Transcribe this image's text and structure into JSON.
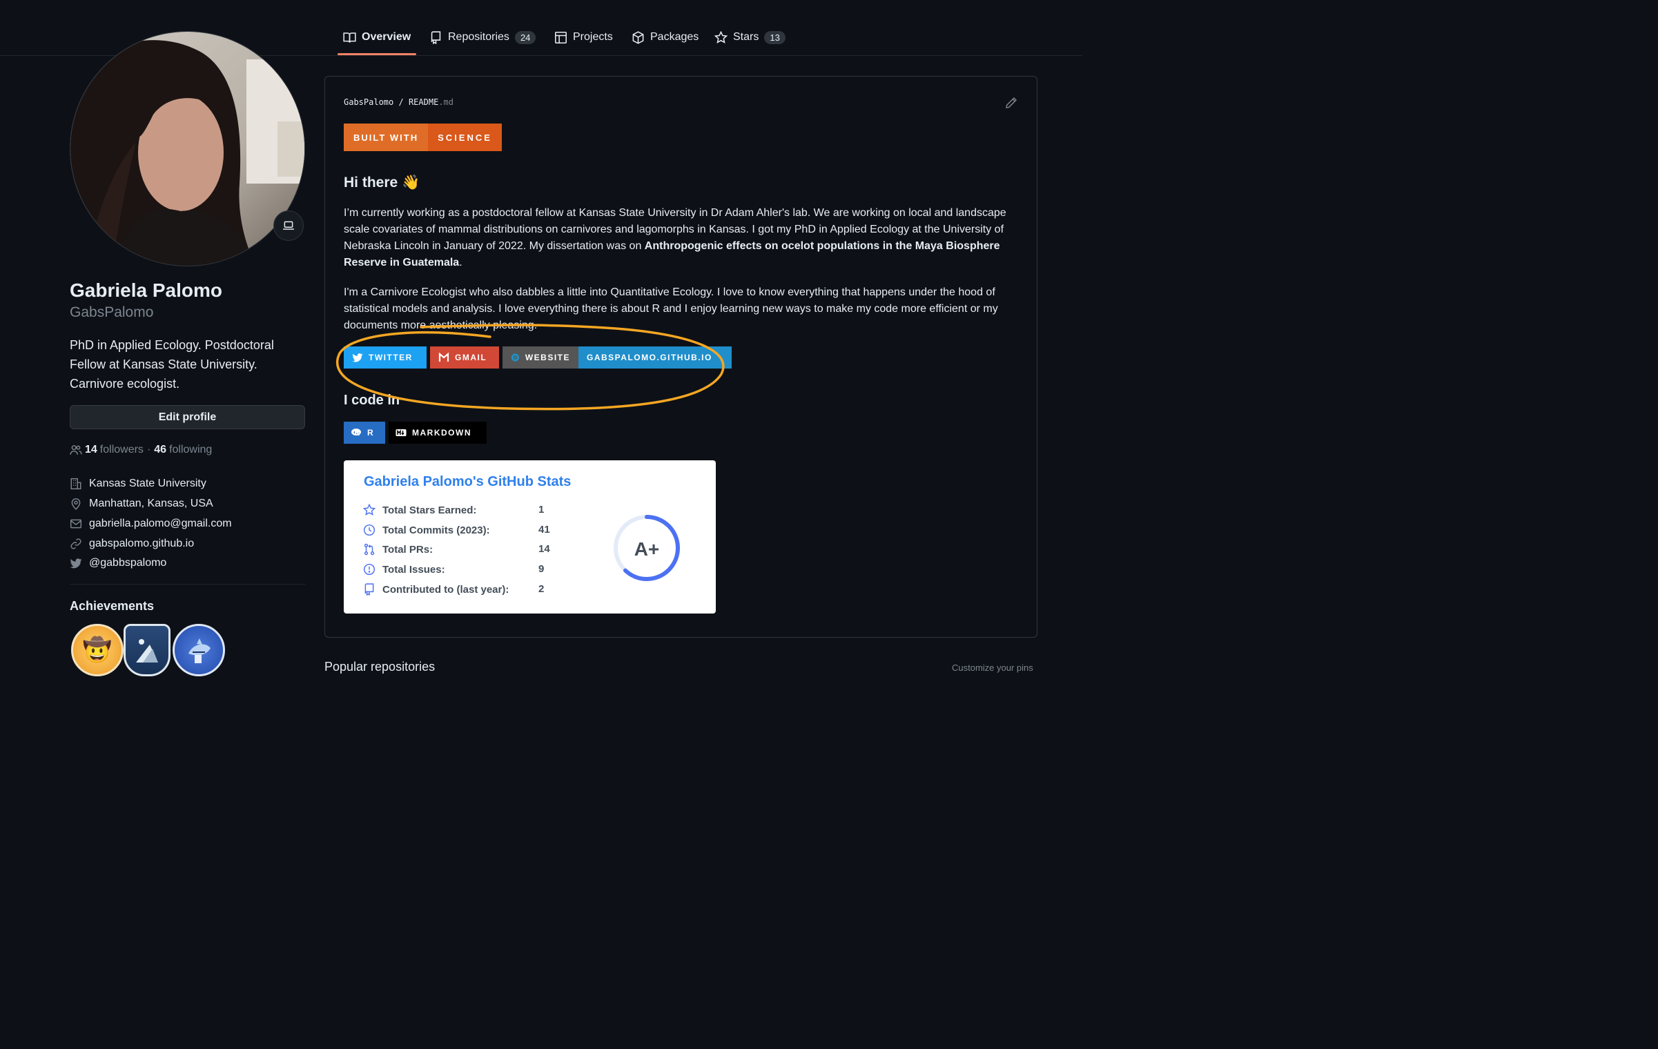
{
  "nav": {
    "tabs": [
      {
        "label": "Overview",
        "count": null,
        "icon": "book-icon"
      },
      {
        "label": "Repositories",
        "count": "24",
        "icon": "repo-icon"
      },
      {
        "label": "Projects",
        "count": null,
        "icon": "table-icon"
      },
      {
        "label": "Packages",
        "count": null,
        "icon": "package-icon"
      },
      {
        "label": "Stars",
        "count": "13",
        "icon": "star-icon"
      }
    ],
    "active": "Overview",
    "accent": "#f78166"
  },
  "profile": {
    "name": "Gabriela Palomo",
    "login": "GabsPalomo",
    "bio": "PhD in Applied Ecology. Postdoctoral Fellow at Kansas State University. Carnivore ecologist.",
    "edit_label": "Edit profile",
    "status_icon": "laptop-icon",
    "followers": "14",
    "followers_label": "followers",
    "separator": "·",
    "following": "46",
    "following_label": "following",
    "details": [
      {
        "icon": "organization-icon",
        "text": "Kansas State University"
      },
      {
        "icon": "location-icon",
        "text": "Manhattan, Kansas, USA"
      },
      {
        "icon": "mail-icon",
        "text": "gabriella.palomo@gmail.com"
      },
      {
        "icon": "link-icon",
        "text": "gabspalomo.github.io"
      },
      {
        "icon": "twitter-icon",
        "text": "@gabbspalomo"
      }
    ],
    "achievements_title": "Achievements"
  },
  "readme": {
    "owner": "GabsPalomo",
    "sep": "/",
    "file": "README",
    "ext": ".md",
    "built_with_left": "BUILT WITH",
    "built_with_right": "SCIENCE",
    "greeting": "Hi there 👋",
    "para1_start": "I’m currently working as a postdoctoral fellow at Kansas State University in Dr Adam Ahler's lab. We are working on local and landscape scale covariates of mammal distributions on carnivores and lagomorphs in Kansas. I got my PhD in Applied Ecology at the University of Nebraska Lincoln in January of 2022. My dissertation was on ",
    "para1_bold": "Anthropogenic effects on ocelot populations in the Maya Biosphere Reserve in Guatemala",
    "para1_end": ".",
    "para2": "I'm a Carnivore Ecologist who also dabbles a little into Quantitative Ecology. I love to know everything that happens under the hood of statistical models and analysis. I love everything there is about R and I enjoy learning new ways to make my code more efficient or my documents more aesthetically pleasing.",
    "social": {
      "twitter": "TWITTER",
      "gmail": "GMAIL",
      "website_left": "WEBSITE",
      "website_right": "GABSPALOMO.GITHUB.IO"
    },
    "code_heading": "I code in",
    "langs": {
      "r": "R",
      "markdown": "MARKDOWN"
    },
    "annotation_color": "#f5a623"
  },
  "stats": {
    "title": "Gabriela Palomo's GitHub Stats",
    "rows": [
      {
        "icon": "star-icon",
        "label": "Total Stars Earned:",
        "value": "1"
      },
      {
        "icon": "history-icon",
        "label": "Total Commits (2023):",
        "value": "41"
      },
      {
        "icon": "pull-request-icon",
        "label": "Total PRs:",
        "value": "14"
      },
      {
        "icon": "issue-icon",
        "label": "Total Issues:",
        "value": "9"
      },
      {
        "icon": "repo-icon",
        "label": "Contributed to (last year):",
        "value": "2"
      }
    ],
    "grade": "A+",
    "grade_progress": 0.62,
    "title_color": "#2f80ed"
  },
  "popular": {
    "title": "Popular repositories",
    "customize": "Customize your pins"
  }
}
